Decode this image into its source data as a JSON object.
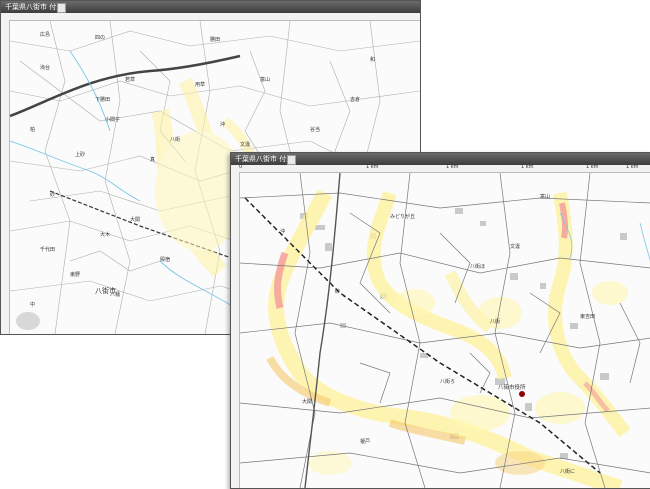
{
  "back_window": {
    "title": "千葉県八街市 付近",
    "city_label": "八街市",
    "labels": [
      "広島",
      "四の",
      "滝台",
      "若草",
      "下勝田",
      "小間子",
      "上砂",
      "大関",
      "殿宿",
      "東野",
      "沖",
      "文違",
      "用草",
      "砂",
      "柏",
      "八街",
      "富山",
      "谷当",
      "吉倉",
      "勝田",
      "千代田",
      "八幡",
      "真",
      "大木",
      "和",
      "大松",
      "中"
    ]
  },
  "front_window": {
    "title": "千葉県八街市 付近",
    "ruler_top_labels": [
      "0",
      "1 km",
      "1 km",
      "1 km",
      "1 km",
      "1 km"
    ],
    "city_hall_label": "八街市役所",
    "labels": [
      "大関",
      "文違",
      "八街",
      "砂",
      "富山",
      "みどりが丘",
      "東吉田",
      "榎戸",
      "沖",
      "八街ほ",
      "八街ろ",
      "八街に"
    ]
  },
  "colors": {
    "titlebar": "#4a4a4a",
    "heat_low": "#fff6a0",
    "heat_mid": "#f7d26a",
    "heat_high": "#f08a8a",
    "river": "#7cc8e8",
    "road": "#555555"
  }
}
